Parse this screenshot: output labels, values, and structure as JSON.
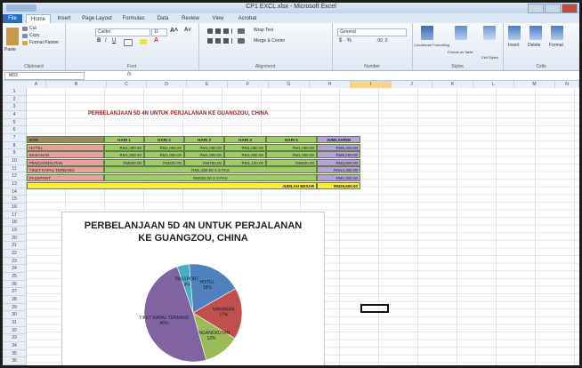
{
  "window": {
    "title": "CP1 EXCL.xlsx - Microsoft Excel"
  },
  "tabs": [
    "File",
    "Home",
    "Insert",
    "Page Layout",
    "Formulas",
    "Data",
    "Review",
    "View",
    "Acrobat"
  ],
  "ribbon": {
    "paste": "Paste",
    "cut": "Cut",
    "copy": "Copy",
    "format_painter": "Format Painter",
    "font_name": "Calibri",
    "font_size": "11",
    "wrap_text": "Wrap Text",
    "merge_center": "Merge & Center",
    "number_format": "General",
    "conditional_formatting": "Conditional Formatting",
    "format_as_table": "Format as Table",
    "cell_styles": "Cell Styles",
    "insert": "Insert",
    "delete": "Delete",
    "format": "Format",
    "groups": [
      "Clipboard",
      "Font",
      "Alignment",
      "Number",
      "Styles",
      "Cells"
    ]
  },
  "formula_bar": {
    "name_box": "M33",
    "fx": "fx"
  },
  "columns": [
    "A",
    "B",
    "C",
    "D",
    "E",
    "F",
    "G",
    "H",
    "I",
    "J",
    "K",
    "L",
    "M",
    "N"
  ],
  "rows": [
    "1",
    "2",
    "3",
    "4",
    "5",
    "6",
    "7",
    "8",
    "9",
    "10",
    "11",
    "12",
    "13",
    "14",
    "15",
    "16",
    "17",
    "18",
    "19",
    "20",
    "21",
    "22",
    "23",
    "24",
    "25",
    "26",
    "27",
    "28",
    "29",
    "30",
    "31",
    "32",
    "33",
    "34",
    "35",
    "36"
  ],
  "sheet": {
    "title": "PERBELANJAAN 5D 4N UNTUK PERJALANAN KE GUANGZOU, CHINA",
    "headers": [
      "KOS",
      "HARI 1",
      "HARI 2",
      "HARI 3",
      "HARI 4",
      "HARI 5",
      "JUMLAH/RM"
    ],
    "rows": [
      {
        "label": "HOTEL",
        "values": [
          "RM1,080.00",
          "RM1,080.00",
          "RM1,080.00",
          "RM1,080.00",
          "RM1,080.00"
        ],
        "total": "RM5,400.00"
      },
      {
        "label": "MAKANAN",
        "values": [
          "RM1,000.00",
          "RM1,000.00",
          "RM1,000.00",
          "RM1,000.00",
          "RM1,000.00"
        ],
        "total": "RM5,000.00"
      },
      {
        "label": "PENGANGKUTAN",
        "values": [
          "RM600.00",
          "RM600.00",
          "RM700.00",
          "RM1,100.00",
          "RM600.00"
        ],
        "total": "RM3,600.00"
      },
      {
        "label": "TIKET KAPAL TERBANG",
        "merged": "RM1,400.00 X 6 PAX",
        "total": "RM14,400.00"
      },
      {
        "label": "PASSPORT",
        "merged": "RM200.00 X 6 PAX",
        "total": "RM1,200.00"
      }
    ],
    "grand_total_label": "JUMLAH BESAR",
    "grand_total": "RM29,600.00"
  },
  "chart_data": {
    "type": "pie",
    "title": "PERBELANJAAN 5D 4N UNTUK PERJALANAN KE GUANGZOU, CHINA",
    "categories": [
      "HOTEL",
      "MAKANAN",
      "PENGANGKUTAN",
      "TIKET KAPAL TERBANG",
      "PASSPORT"
    ],
    "values": [
      18,
      17,
      12,
      49,
      4
    ],
    "labels": [
      "HOTEL\n18%",
      "MAKANAN\n17%",
      "PENGANGKUTAN\n12%",
      "TIKET KAPAL TERBANG\n49%",
      "PASSPORT\n4%"
    ],
    "colors": [
      "#4f81bd",
      "#c0504d",
      "#9bbb59",
      "#8064a2",
      "#4bacc6"
    ]
  },
  "colors": {
    "header_bar": "#c7d9f0",
    "title_red": "#8b1a1a",
    "kos_pink": "#e6a0a0",
    "hari_green": "#9ccc65",
    "total_purple": "#b3a2d8",
    "grand_yellow": "#ffeb3b"
  }
}
